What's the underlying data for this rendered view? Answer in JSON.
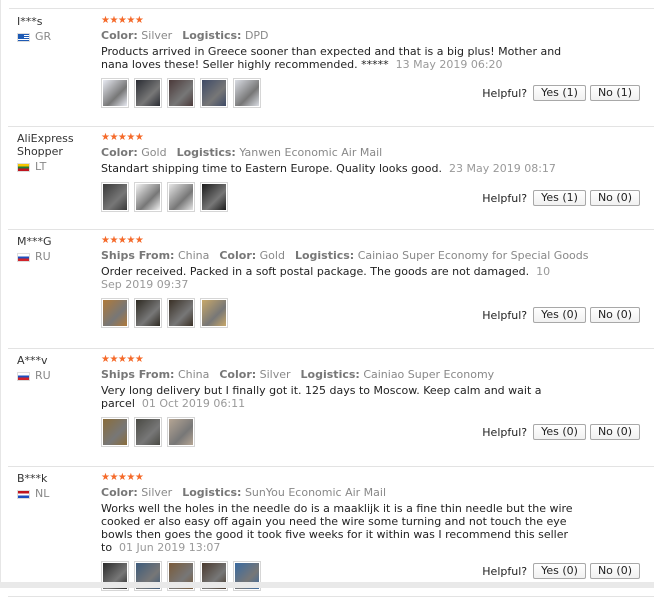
{
  "labels": {
    "color": "Color:",
    "logistics": "Logistics:",
    "ships_from": "Ships From:",
    "helpful": "Helpful?",
    "yes": "Yes",
    "no": "No"
  },
  "colors": {
    "stars": "#f56a2a",
    "meta_text": "#888888",
    "border": "#e3e3e3"
  },
  "reviews": [
    {
      "buyer": "I***s",
      "country": "GR",
      "flag_icon": "greece-flag-icon",
      "stars": "★★★★★",
      "ships_from": "",
      "color": "Silver",
      "logistics": "DPD",
      "text": "Products arrived in Greece sooner than expected and that is a big plus! Mother and nana loves these! Seller highly recommended. *****",
      "date": "13 May 2019 06:20",
      "yes": "Yes (1)",
      "no": "No (1)",
      "thumbs": 5
    },
    {
      "buyer": "AliExpress Shopper",
      "country": "LT",
      "flag_icon": "lithuania-flag-icon",
      "stars": "★★★★★",
      "ships_from": "",
      "color": "Gold",
      "logistics": "Yanwen Economic Air Mail",
      "text": "Standart shipping time to Eastern Europe. Quality looks good.",
      "date": "23 May 2019 08:17",
      "yes": "Yes (1)",
      "no": "No (0)",
      "thumbs": 4
    },
    {
      "buyer": "M***G",
      "country": "RU",
      "flag_icon": "russia-flag-icon",
      "stars": "★★★★★",
      "ships_from": "China",
      "color": "Gold",
      "logistics": "Cainiao Super Economy for Special Goods",
      "text": "Order received. Packed in a soft postal package. The goods are not damaged.",
      "date": "10 Sep 2019 09:37",
      "yes": "Yes (0)",
      "no": "No (0)",
      "thumbs": 4
    },
    {
      "buyer": "A***v",
      "country": "RU",
      "flag_icon": "russia-flag-icon",
      "stars": "★★★★★",
      "ships_from": "China",
      "color": "Silver",
      "logistics": "Cainiao Super Economy",
      "text": "Very long delivery but I finally got it. 125 days to Moscow. Keep calm and wait a parcel",
      "date": "01 Oct 2019 06:11",
      "yes": "Yes (0)",
      "no": "No (0)",
      "thumbs": 3
    },
    {
      "buyer": "B***k",
      "country": "NL",
      "flag_icon": "netherlands-flag-icon",
      "stars": "★★★★★",
      "ships_from": "",
      "color": "Silver",
      "logistics": "SunYou Economic Air Mail",
      "text": "Works well the holes in the needle do is a maaklijk it is a fine thin needle but the wire cooked er also easy off again you need the wire some turning and not touch the eye bowls then goes the good it took five weeks for it within was I recommend this seller to",
      "date": "01 Jun 2019 13:07",
      "yes": "Yes (0)",
      "no": "No (0)",
      "thumbs": 5
    }
  ]
}
